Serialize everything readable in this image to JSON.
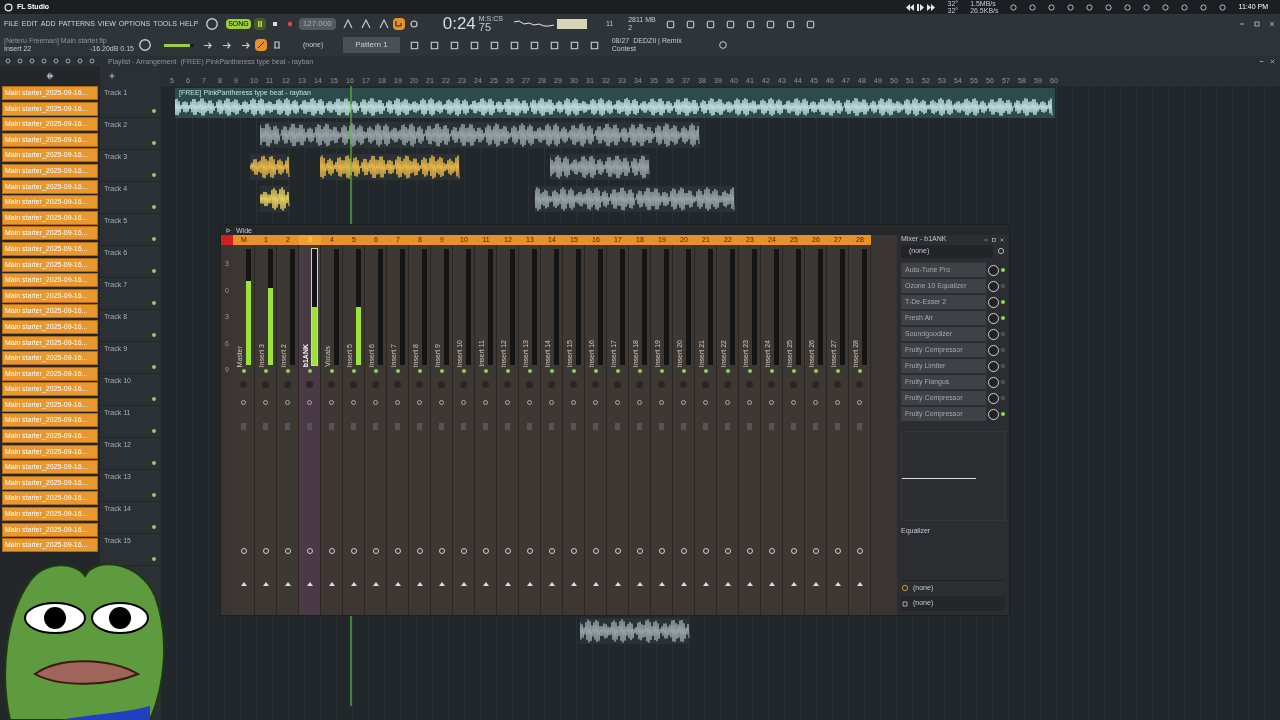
{
  "window": {
    "title": "FL Studio",
    "clock": "11:40 PM"
  },
  "tray": {
    "temps": [
      "32°",
      "32°"
    ],
    "network": [
      "1.5MB/s",
      "26.5KB/s"
    ]
  },
  "menu": [
    "FILE",
    "EDIT",
    "ADD",
    "PATTERNS",
    "VIEW",
    "OPTIONS",
    "TOOLS",
    "HELP"
  ],
  "master_volume": {
    "level": 0.85
  },
  "transport": {
    "mode": "SONG",
    "tempo": "127.000",
    "time": "0:24",
    "time_cs": "75",
    "time_unit": "M:S:CS",
    "cpu": "11",
    "memory": "2811 MB",
    "polyphony": "2"
  },
  "hint": {
    "project": "[Neteru Freeman] Main starter.flp",
    "target": "Insert 22",
    "value": "-16.20dB 0.15"
  },
  "pattern": {
    "channel": "(none)",
    "name": "Pattern 1"
  },
  "news": {
    "date": "08/27",
    "title": "DEDZII | Remix",
    "subtitle": "Contest"
  },
  "playlist": {
    "breadcrumb": [
      "Playlist - Arrangement",
      "(FREE) PinkPantheress type beat - rayban"
    ],
    "ruler": [
      "5",
      "6",
      "7",
      "8",
      "9",
      "10",
      "11",
      "12",
      "13",
      "14",
      "15",
      "16",
      "17",
      "18",
      "19",
      "20",
      "21",
      "22",
      "23",
      "24",
      "25",
      "26",
      "27",
      "28",
      "29",
      "30",
      "31",
      "32",
      "33",
      "34",
      "35",
      "36",
      "37",
      "38",
      "39",
      "40",
      "41",
      "42",
      "43",
      "44",
      "45",
      "46",
      "47",
      "48",
      "49",
      "50",
      "51",
      "52",
      "53",
      "54",
      "55",
      "56",
      "57",
      "58",
      "59",
      "60"
    ],
    "clips": [
      "Main starter_2025-09-16...",
      "Main starter_2025-09-16...",
      "Main starter_2025-09-16...",
      "Main starter_2025-09-16...",
      "Main starter_2025-09-16...",
      "Main starter_2025-09-16...",
      "Main starter_2025-09-16...",
      "Main starter_2025-09-16...",
      "Main starter_2025-09-16...",
      "Main starter_2025-09-16...",
      "Main starter_2025-09-16...",
      "Main starter_2025-09-16...",
      "Main starter_2025-09-16...",
      "Main starter_2025-09-16...",
      "Main starter_2025-09-16...",
      "Main starter_2025-09-16...",
      "Main starter_2025-09-16...",
      "Main starter_2025-09-16...",
      "Main starter_2025-09-16...",
      "Main starter_2025-09-16...",
      "Main starter_2025-09-16...",
      "Main starter_2025-09-16...",
      "Main starter_2025-09-16...",
      "Main starter_2025-09-16...",
      "Main starter_2025-09-16...",
      "Main starter_2025-09-16...",
      "Main starter_2025-09-16...",
      "Main starter_2025-09-16...",
      "Main starter_2025-09-16...",
      "Main starter_2025-09-16..."
    ],
    "tracks": [
      "Track 1",
      "Track 2",
      "Track 3",
      "Track 4",
      "Track 5",
      "Track 6",
      "Track 7",
      "Track 8",
      "Track 9",
      "Track 10",
      "Track 11",
      "Track 12",
      "Track 13",
      "Track 14",
      "Track 15"
    ],
    "main_clip": "[FREE] PinkPantheress type beat - rayban"
  },
  "mixer": {
    "mode": "Wide",
    "scale": [
      "3",
      "0",
      "3",
      "6",
      "9"
    ],
    "strips": [
      {
        "number": "M",
        "name": "Master",
        "level": 0.72,
        "selected": false
      },
      {
        "number": "1",
        "name": "Insert 3",
        "level": 0.66,
        "selected": false
      },
      {
        "number": "2",
        "name": "Insert 2",
        "selected": false
      },
      {
        "number": "3",
        "name": "b1ANK",
        "level": 0.5,
        "selected": true
      },
      {
        "number": "4",
        "name": "Vocals",
        "selected": false
      },
      {
        "number": "5",
        "name": "Insert 5",
        "level": 0.5,
        "selected": false
      },
      {
        "number": "6",
        "name": "Insert 6",
        "selected": false
      },
      {
        "number": "7",
        "name": "Insert 7",
        "selected": false
      },
      {
        "number": "8",
        "name": "Insert 8",
        "selected": false
      },
      {
        "number": "9",
        "name": "Insert 9",
        "selected": false
      },
      {
        "number": "10",
        "name": "Insert 10",
        "selected": false
      },
      {
        "number": "11",
        "name": "Insert 11",
        "selected": false
      },
      {
        "number": "12",
        "name": "Insert 12",
        "selected": false
      },
      {
        "number": "13",
        "name": "Insert 13",
        "selected": false
      },
      {
        "number": "14",
        "name": "Insert 14",
        "selected": false
      },
      {
        "number": "15",
        "name": "Insert 15",
        "selected": false
      },
      {
        "number": "16",
        "name": "Insert 16",
        "selected": false
      },
      {
        "number": "17",
        "name": "Insert 17",
        "selected": false
      },
      {
        "number": "18",
        "name": "Insert 18",
        "selected": false
      },
      {
        "number": "19",
        "name": "Insert 19",
        "selected": false
      },
      {
        "number": "20",
        "name": "Insert 20",
        "selected": false
      },
      {
        "number": "21",
        "name": "Insert 21",
        "selected": false
      },
      {
        "number": "22",
        "name": "Insert 22",
        "selected": false
      },
      {
        "number": "23",
        "name": "Insert 23",
        "selected": false
      },
      {
        "number": "24",
        "name": "Insert 24",
        "selected": false
      },
      {
        "number": "25",
        "name": "Insert 25",
        "selected": false
      },
      {
        "number": "26",
        "name": "Insert 26",
        "selected": false
      },
      {
        "number": "27",
        "name": "Insert 27",
        "selected": false
      },
      {
        "number": "28",
        "name": "Insert 28",
        "selected": false
      }
    ],
    "insert": {
      "title": "Mixer - b1ANK",
      "input": "(none)",
      "effects": [
        {
          "name": "Auto-Tune Pro",
          "enabled": true
        },
        {
          "name": "Ozone 10 Equalizer",
          "enabled": false
        },
        {
          "name": "T-De-Esser 2",
          "enabled": true
        },
        {
          "name": "Fresh Air",
          "enabled": true
        },
        {
          "name": "Soundgoodizer",
          "enabled": false
        },
        {
          "name": "Fruity Compressor",
          "enabled": false
        },
        {
          "name": "Fruity Limiter",
          "enabled": false
        },
        {
          "name": "Fruity Flangus",
          "enabled": false
        },
        {
          "name": "Fruity Compressor",
          "enabled": false
        },
        {
          "name": "Fruity Compressor",
          "enabled": true
        }
      ],
      "eq_label": "Equalizer",
      "output": "(none)",
      "sidechain": "(none)"
    }
  }
}
